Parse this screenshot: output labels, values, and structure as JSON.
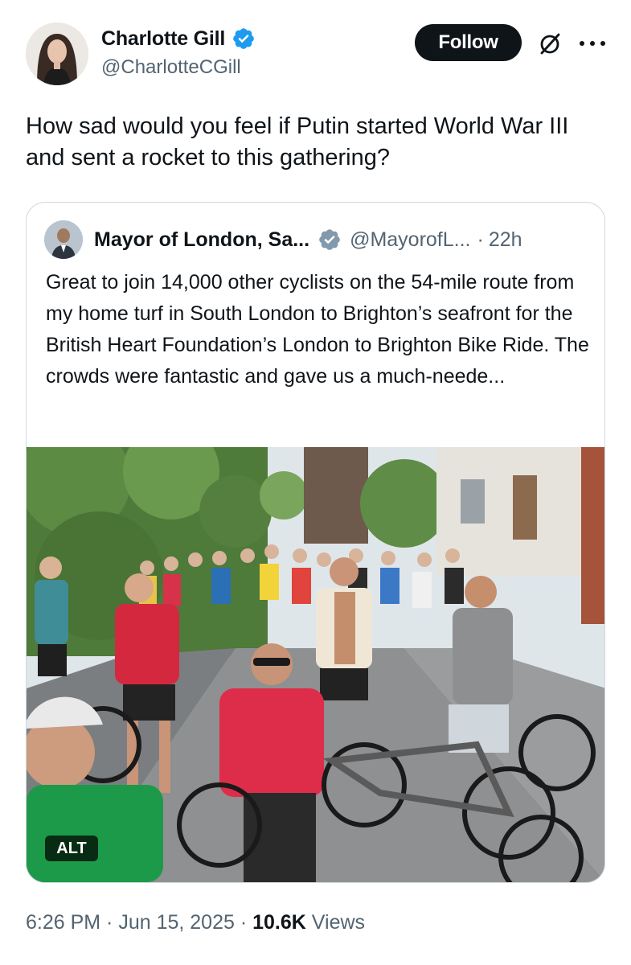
{
  "author": {
    "display_name": "Charlotte Gill",
    "handle": "@CharlotteCGill",
    "verified": true
  },
  "actions": {
    "follow_label": "Follow",
    "grok_icon": "grok-icon",
    "more_icon": "more-icon"
  },
  "tweet": {
    "text": "How sad would you feel if Putin started World War III and sent a rocket to this gathering?"
  },
  "quote": {
    "display_name": "Mayor of London, Sa...",
    "verified_color": "gray",
    "handle": "@MayorofL...",
    "separator": "·",
    "time": "22h",
    "text": "Great to join 14,000 other cyclists on the 54-mile route from my home turf in South London to Brighton’s seafront for the British Heart Foundation’s London to Brighton Bike Ride. The crowds were fantastic and gave us a much-neede...",
    "alt_label": "ALT"
  },
  "footer": {
    "time": "6:26 PM",
    "sep1": " · ",
    "date": "Jun 15, 2025",
    "sep2": " · ",
    "views_count": "10.6K",
    "views_label": " Views"
  },
  "colors": {
    "text": "#0f1419",
    "secondary": "#536471",
    "border": "#cfd9de",
    "verified_blue": "#1d9bf0",
    "verified_gray": "#829aab"
  }
}
